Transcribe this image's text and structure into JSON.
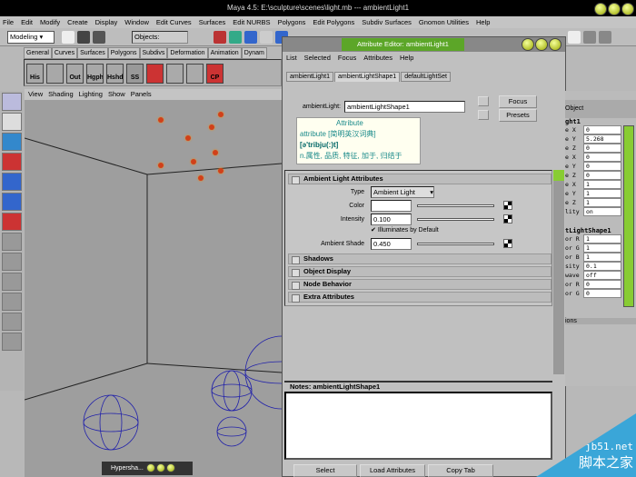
{
  "window": {
    "title": "Maya 4.5: E:\\sculpture\\scenes\\light.mb  ---  ambientLight1"
  },
  "menu": [
    "File",
    "Edit",
    "Modify",
    "Create",
    "Display",
    "Window",
    "Edit Curves",
    "Surfaces",
    "Edit NURBS",
    "Polygons",
    "Edit Polygons",
    "Subdiv Surfaces",
    "Gnomon Utilities",
    "Help"
  ],
  "toolbar": {
    "mode": "Modeling",
    "objects_field": "Objects:"
  },
  "shelf": {
    "tabs": [
      "General",
      "Curves",
      "Surfaces",
      "Polygons",
      "Subdivs",
      "Deformation",
      "Animation",
      "Dynam"
    ],
    "items": [
      "His",
      "",
      "Out",
      "Hgph",
      "Hshd",
      "SS",
      "",
      "",
      "",
      "CP"
    ]
  },
  "viewport": {
    "menu": [
      "View",
      "Shading",
      "Lighting",
      "Show",
      "Panels"
    ],
    "taskbar": "Hypersha..."
  },
  "attr_editor": {
    "title": "Attribute Editor: ambientLight1",
    "menu": [
      "List",
      "Selected",
      "Focus",
      "Attributes",
      "Help"
    ],
    "tabs": [
      "ambientLight1",
      "ambientLightShape1",
      "defaultLightSet"
    ],
    "active_tab": 1,
    "node_label": "ambientLight:",
    "node_name": "ambientLightShape1",
    "focus_button": "Focus",
    "presets_button": "Presets",
    "tooltip": {
      "title": "Attribute",
      "line1": "attribute [简明英汉词典]",
      "line2": "[ə'tribju(:)t]",
      "line3": "n.属性, 品质, 特征, 加于, 归结于"
    },
    "sections": [
      {
        "title": "Ambient Light Attributes",
        "expanded": true
      },
      {
        "title": "Shadows"
      },
      {
        "title": "Object Display"
      },
      {
        "title": "Node Behavior"
      },
      {
        "title": "Extra Attributes"
      }
    ],
    "attrs": {
      "type_label": "Type",
      "type_value": "Ambient Light",
      "color_label": "Color",
      "color_value": "#ffffff",
      "intensity_label": "Intensity",
      "intensity": "0.100",
      "illum_label": "Illuminates by Default",
      "illum_checked": true,
      "shade_label": "Ambient Shade",
      "shade": "0.450"
    },
    "notes_label": "Notes: ambientLightShape1",
    "buttons": [
      "Select",
      "Load Attributes",
      "Copy Tab"
    ]
  },
  "channel_box": {
    "header": "Object",
    "node1": "ght1",
    "rows1": [
      [
        "e X",
        "0"
      ],
      [
        "e Y",
        "5.268"
      ],
      [
        "e Z",
        "0"
      ],
      [
        "e X",
        "0"
      ],
      [
        "e Y",
        "0"
      ],
      [
        "e Z",
        "0"
      ],
      [
        "e X",
        "1"
      ],
      [
        "e Y",
        "1"
      ],
      [
        "e Z",
        "1"
      ],
      [
        "lity",
        "on"
      ]
    ],
    "node2": "tLightShape1",
    "rows2": [
      [
        "or R",
        "1"
      ],
      [
        "or G",
        "1"
      ],
      [
        "or B",
        "1"
      ],
      [
        "sity",
        "0.1"
      ],
      [
        "wave",
        "off"
      ],
      [
        "or R",
        "0"
      ],
      [
        "or G",
        "0"
      ]
    ],
    "layers": "ions"
  },
  "watermark": {
    "line1": "jb51.net",
    "line2": "脚本之家"
  },
  "colors": {
    "title_green": "#5ca628",
    "viewport": "#9e9e9e",
    "light": "#d0401a"
  }
}
